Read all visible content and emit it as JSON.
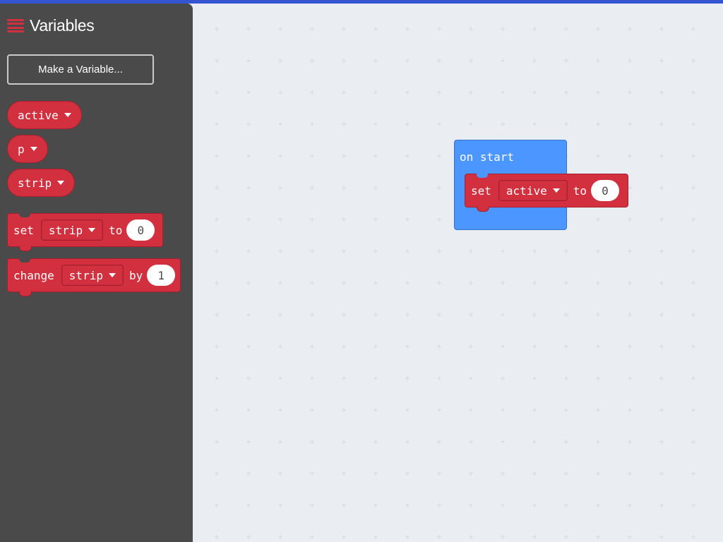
{
  "flyout": {
    "title": "Variables",
    "make_variable_button": "Make a Variable...",
    "variables": [
      {
        "name": "active"
      },
      {
        "name": "p"
      },
      {
        "name": "strip"
      }
    ],
    "set_block": {
      "keyword": "set",
      "variable": "strip",
      "connector": "to",
      "value": "0"
    },
    "change_block": {
      "keyword": "change",
      "variable": "strip",
      "connector": "by",
      "value": "1"
    }
  },
  "workspace": {
    "event_block": {
      "label": "on start"
    },
    "set_block": {
      "keyword": "set",
      "variable": "active",
      "connector": "to",
      "value": "0"
    }
  },
  "colors": {
    "accent_bar": "#3454d1",
    "flyout_bg": "#4b4a4b",
    "variables_category": "#d2303f",
    "basic_category": "#4c97ff",
    "workspace_bg": "#eaeef2"
  },
  "icons": {
    "category": "hamburger-menu-icon",
    "dropdown": "caret-down-icon"
  }
}
